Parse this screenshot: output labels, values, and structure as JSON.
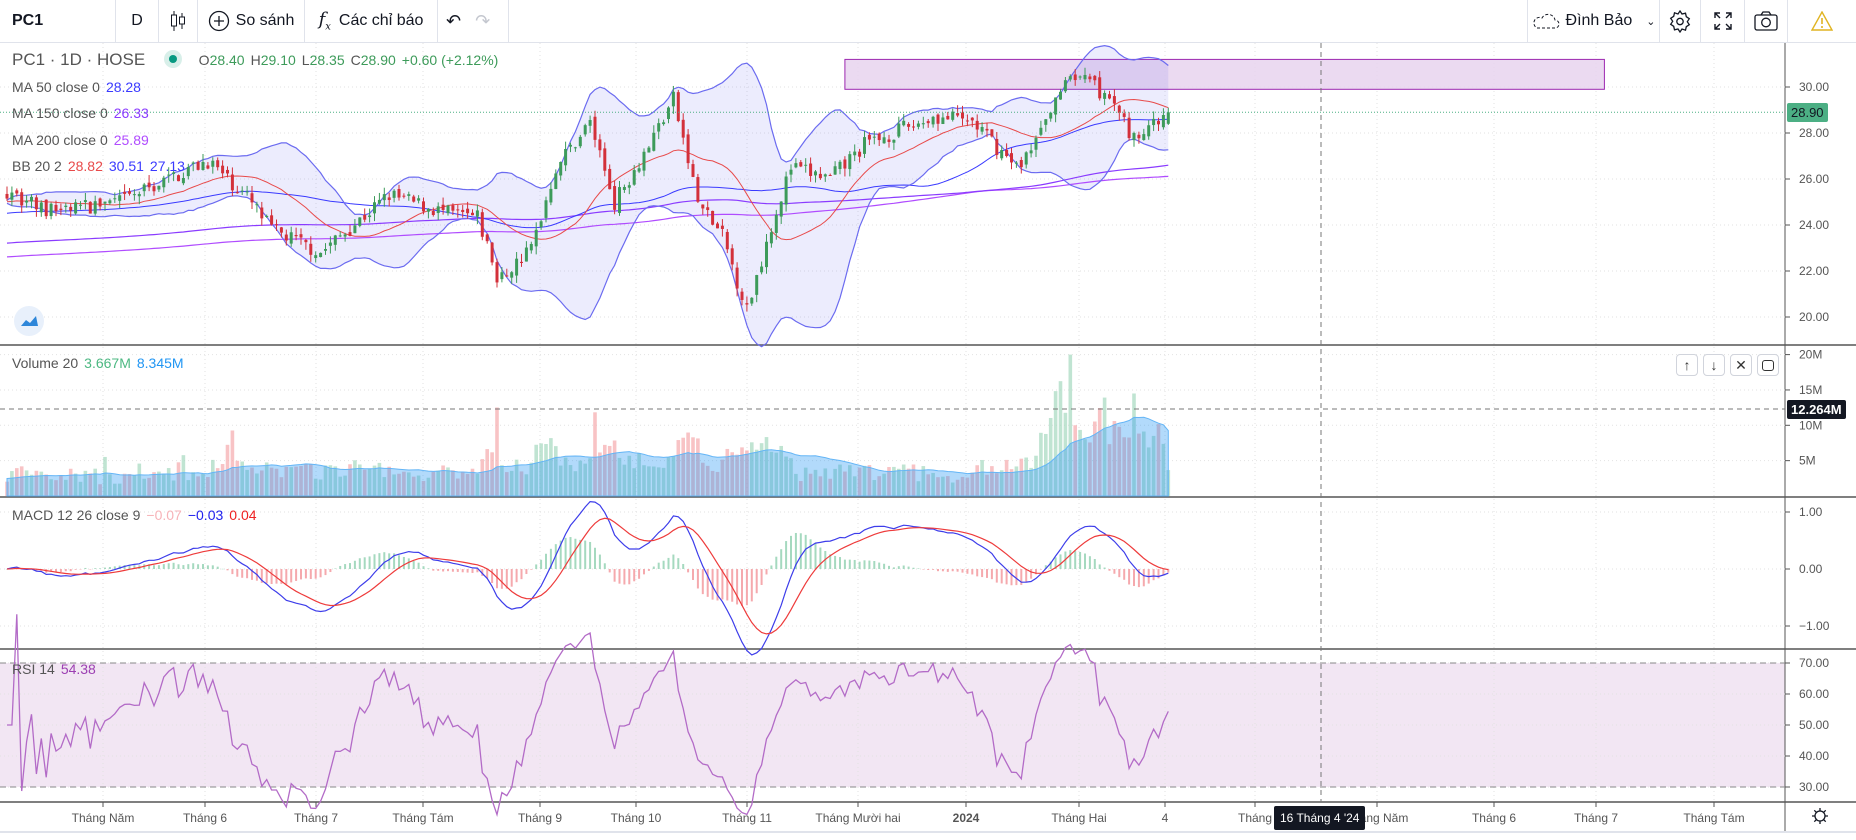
{
  "toolbar": {
    "symbol": "PC1",
    "interval": "D",
    "compare_label": "So sánh",
    "indicators_label": "Các chỉ báo",
    "layout_name": "Đình Bảo",
    "icons": [
      "candlestick-icon",
      "plus-circle-icon",
      "function-icon",
      "undo-icon",
      "redo-icon",
      "cloud-icon",
      "chevron-down-icon",
      "gear-icon",
      "fullscreen-icon",
      "camera-icon",
      "warning-icon"
    ]
  },
  "legend": {
    "title": "PC1 · 1D · HOSE",
    "o_label": "O",
    "o": "28.40",
    "h_label": "H",
    "h": "29.10",
    "l_label": "L",
    "l": "28.35",
    "c_label": "C",
    "c": "28.90",
    "change": "+0.60 (+2.12%)",
    "ma50_label": "MA 50 close 0",
    "ma50": "28.28",
    "ma150_label": "MA 150 close 0",
    "ma150": "26.33",
    "ma200_label": "MA 200 close 0",
    "ma200": "25.89",
    "bb_label": "BB 20 2",
    "bb_basis": "28.82",
    "bb_upper": "30.51",
    "bb_lower": "27.13"
  },
  "volume": {
    "label": "Volume 20",
    "value": "3.667M",
    "ma": "8.345M",
    "crosshair_value": "12.264M"
  },
  "macd": {
    "label": "MACD 12 26 close 9",
    "hist": "−0.07",
    "macd": "−0.03",
    "signal": "0.04"
  },
  "rsi": {
    "label": "RSI 14",
    "value": "54.38"
  },
  "price_axis": {
    "ticks": [
      "30.00",
      "28.00",
      "26.00",
      "24.00",
      "22.00",
      "20.00"
    ],
    "last_price": "28.90"
  },
  "volume_axis": {
    "ticks": [
      "20M",
      "15M",
      "10M",
      "5M"
    ]
  },
  "macd_axis": {
    "ticks": [
      "1.00",
      "0.00",
      "−1.00"
    ]
  },
  "rsi_axis": {
    "ticks": [
      "70.00",
      "60.00",
      "50.00",
      "40.00",
      "30.00"
    ]
  },
  "time_axis": {
    "labels": [
      "Tháng Năm",
      "Tháng 6",
      "Tháng 7",
      "Tháng Tám",
      "Tháng 9",
      "Tháng 10",
      "Tháng 11",
      "Tháng Mười hai",
      "2024",
      "Tháng Hai",
      "4",
      "Tháng",
      "Tháng Năm",
      "Tháng 6",
      "Tháng 7",
      "Tháng Tám"
    ],
    "crosshair_label": "16 Tháng 4 '24"
  },
  "colors": {
    "up": "#3d9b5a",
    "down": "#d3303a",
    "bb": "#6b6bf0",
    "bb_basis": "#e84a4a",
    "ma50": "#3a3aff",
    "ma150": "#8a3bff",
    "ma200": "#b04cff",
    "rsi": "#b36bc7",
    "accent_last": "#4caf84",
    "zone": "#e8d3ee"
  },
  "chart_data": {
    "type": "candlestick",
    "symbol": "PC1",
    "bars": 238,
    "close_waypoints": [
      [
        0,
        25.5
      ],
      [
        8,
        24.6
      ],
      [
        23,
        25.0
      ],
      [
        41,
        26.8
      ],
      [
        49,
        25.2
      ],
      [
        54,
        23.8
      ],
      [
        64,
        22.8
      ],
      [
        78,
        25.3
      ],
      [
        90,
        24.5
      ],
      [
        96,
        24.3
      ],
      [
        99,
        22.5
      ],
      [
        100,
        21.5
      ],
      [
        107,
        23.0
      ],
      [
        112,
        26.5
      ],
      [
        119,
        28.5
      ],
      [
        124,
        25.0
      ],
      [
        131,
        27.5
      ],
      [
        136,
        29.5
      ],
      [
        141,
        25.0
      ],
      [
        146,
        23.5
      ],
      [
        151,
        20.3
      ],
      [
        156,
        24.0
      ],
      [
        160,
        26.5
      ],
      [
        168,
        26.0
      ],
      [
        175,
        27.5
      ],
      [
        189,
        28.7
      ],
      [
        197,
        28.5
      ],
      [
        206,
        26.5
      ],
      [
        211,
        28.0
      ],
      [
        217,
        30.8
      ],
      [
        223,
        29.8
      ],
      [
        230,
        27.8
      ],
      [
        237,
        28.9
      ]
    ],
    "last_bar": {
      "open": 28.4,
      "high": 29.1,
      "low": 28.35,
      "close": 28.9
    },
    "zone": {
      "from_bar": 171,
      "to_bar": 326,
      "price_low": 29.9,
      "price_high": 31.2
    },
    "price_range": [
      19.3,
      31.6
    ],
    "volume_range_M": [
      0,
      21
    ],
    "macd_range": [
      -1.3,
      1.2
    ],
    "rsi_range": [
      27,
      72
    ]
  }
}
